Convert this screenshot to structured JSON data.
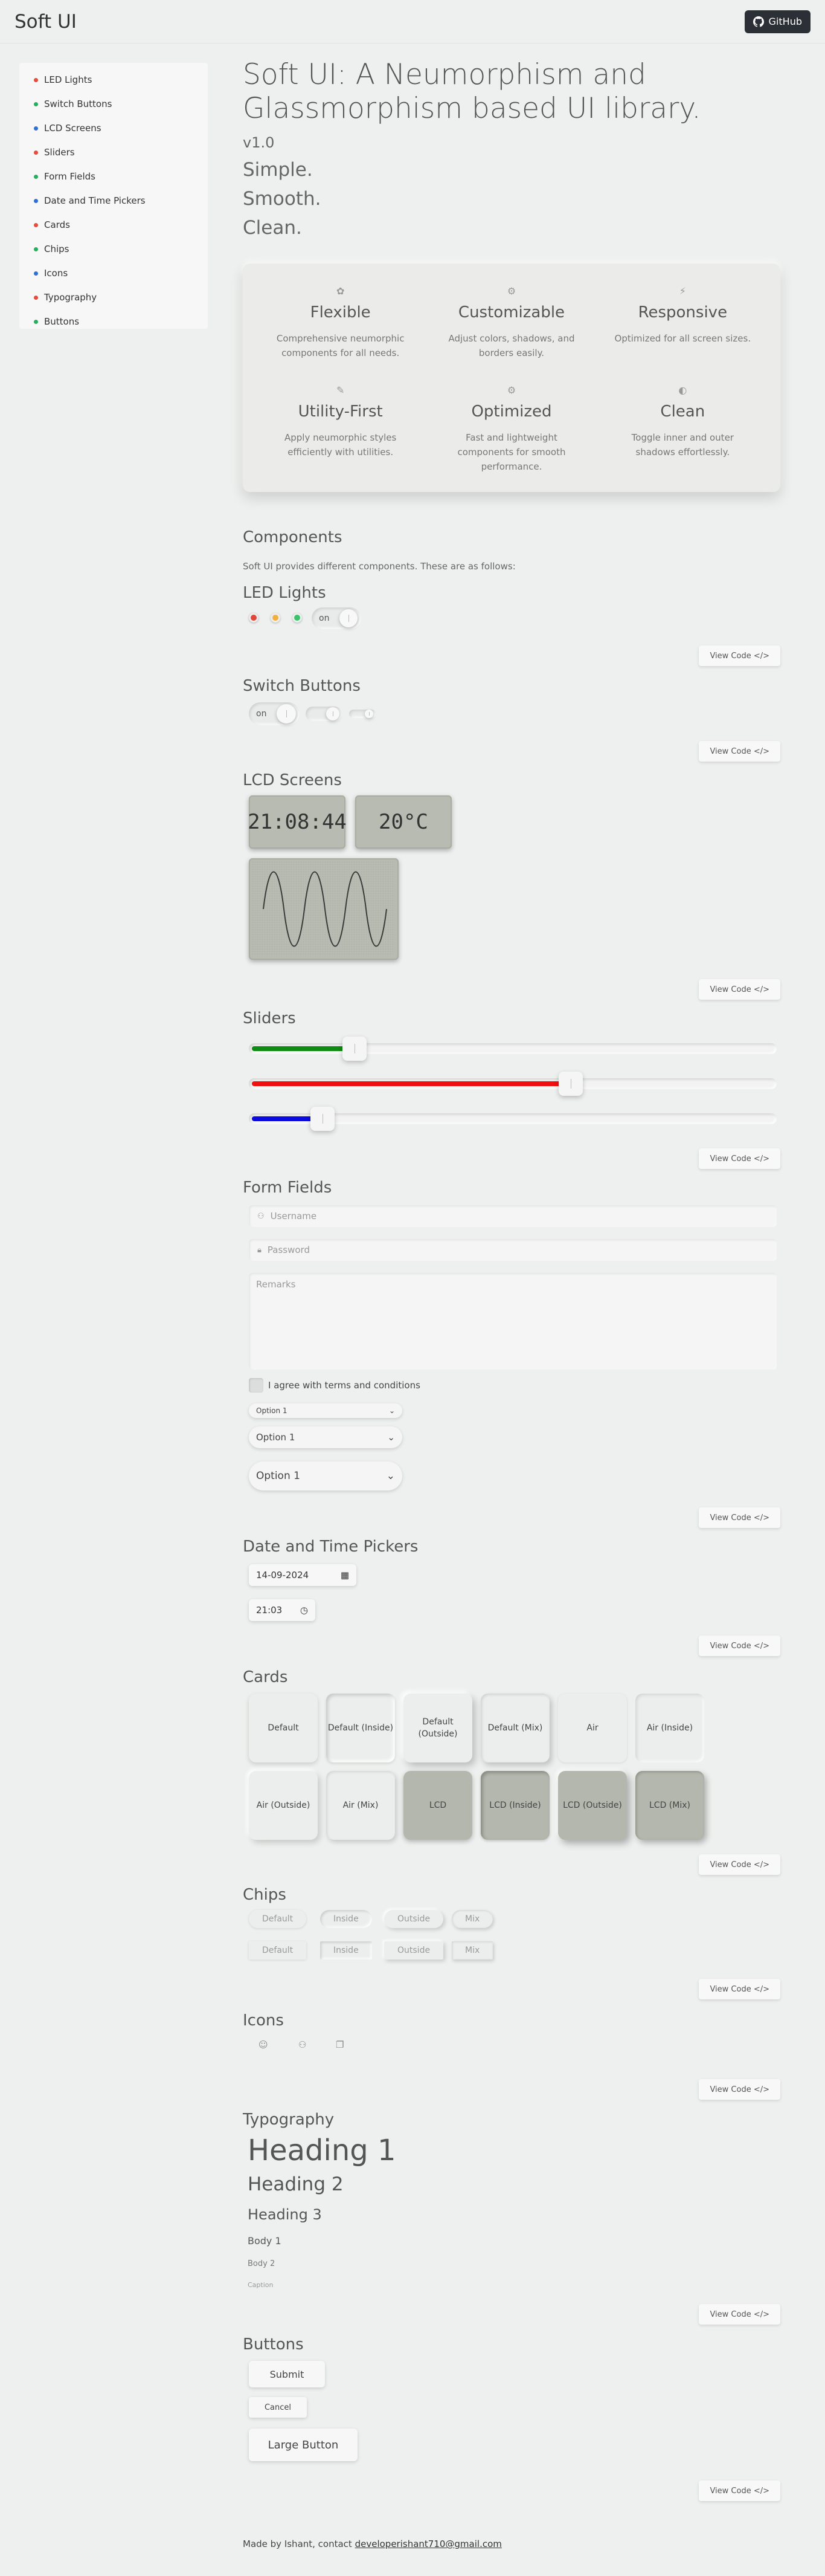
{
  "navbar": {
    "brand": "Soft UI",
    "github_label": "GitHub"
  },
  "sidebar": {
    "items": [
      {
        "label": "LED Lights",
        "color": "#e74c3c"
      },
      {
        "label": "Switch Buttons",
        "color": "#27ae60"
      },
      {
        "label": "LCD Screens",
        "color": "#2f6fd6"
      },
      {
        "label": "Sliders",
        "color": "#e74c3c"
      },
      {
        "label": "Form Fields",
        "color": "#27ae60"
      },
      {
        "label": "Date and Time Pickers",
        "color": "#2f6fd6"
      },
      {
        "label": "Cards",
        "color": "#e74c3c"
      },
      {
        "label": "Chips",
        "color": "#27ae60"
      },
      {
        "label": "Icons",
        "color": "#2f6fd6"
      },
      {
        "label": "Typography",
        "color": "#e74c3c"
      },
      {
        "label": "Buttons",
        "color": "#27ae60"
      }
    ]
  },
  "hero": {
    "title": "Soft UI: A Neumorphism and Glassmorphism based UI library.",
    "version": "v1.0",
    "lines": [
      "Simple.",
      "Smooth.",
      "Clean."
    ]
  },
  "features": [
    {
      "icon": "✿",
      "title": "Flexible",
      "desc": "Comprehensive neumorphic components for all needs."
    },
    {
      "icon": "⚙",
      "title": "Customizable",
      "desc": "Adjust colors, shadows, and borders easily."
    },
    {
      "icon": "⚡",
      "title": "Responsive",
      "desc": "Optimized for all screen sizes."
    },
    {
      "icon": "✎",
      "title": "Utility-First",
      "desc": "Apply neumorphic styles efficiently with utilities."
    },
    {
      "icon": "⚙",
      "title": "Optimized",
      "desc": "Fast and lightweight components for smooth performance."
    },
    {
      "icon": "◐",
      "title": "Clean",
      "desc": "Toggle inner and outer shadows effortlessly."
    }
  ],
  "components": {
    "title": "Components",
    "subtitle": "Soft UI provides different components. These are as follows:",
    "view_code": "View Code </>"
  },
  "led": {
    "title": "LED Lights",
    "colors": [
      "#e0463a",
      "#f0b040",
      "#39c36a"
    ],
    "switch_label": "on"
  },
  "switches": {
    "title": "Switch Buttons",
    "label": "on"
  },
  "lcd": {
    "title": "LCD Screens",
    "time": "21:08:44",
    "temp": "20°C"
  },
  "sliders": {
    "title": "Sliders",
    "items": [
      {
        "color": "#0f8a12",
        "value": 0.2
      },
      {
        "color": "#f01010",
        "value": 0.61
      },
      {
        "color": "#0a0ae0",
        "value": 0.14
      }
    ]
  },
  "form": {
    "title": "Form Fields",
    "username_placeholder": "Username",
    "password_placeholder": "Password",
    "remarks_placeholder": "Remarks",
    "checkbox_label": "I agree with terms and conditions",
    "select_value": "Option 1"
  },
  "datetime": {
    "title": "Date and Time Pickers",
    "date": "14-09-2024",
    "time": "21:03"
  },
  "cards": {
    "title": "Cards",
    "items": [
      "Default",
      "Default (Inside)",
      "Default (Outside)",
      "Default (Mix)",
      "Air",
      "Air (Inside)",
      "Air (Outside)",
      "Air (Mix)",
      "LCD",
      "LCD (Inside)",
      "LCD (Outside)",
      "LCD (Mix)"
    ]
  },
  "chips": {
    "title": "Chips",
    "items": [
      "Default",
      "Inside",
      "Outside",
      "Mix"
    ]
  },
  "icons": {
    "title": "Icons",
    "items": [
      "robot-icon",
      "user-icon",
      "chat-icon"
    ]
  },
  "typography": {
    "title": "Typography",
    "h1": "Heading 1",
    "h2": "Heading 2",
    "h3": "Heading 3",
    "body1": "Body 1",
    "body2": "Body 2",
    "caption": "Caption"
  },
  "buttons": {
    "title": "Buttons",
    "submit": "Submit",
    "cancel": "Cancel",
    "large": "Large Button"
  },
  "footer": {
    "text": "Made by Ishant, contact ",
    "email": "developerishant710@gmail.com"
  }
}
